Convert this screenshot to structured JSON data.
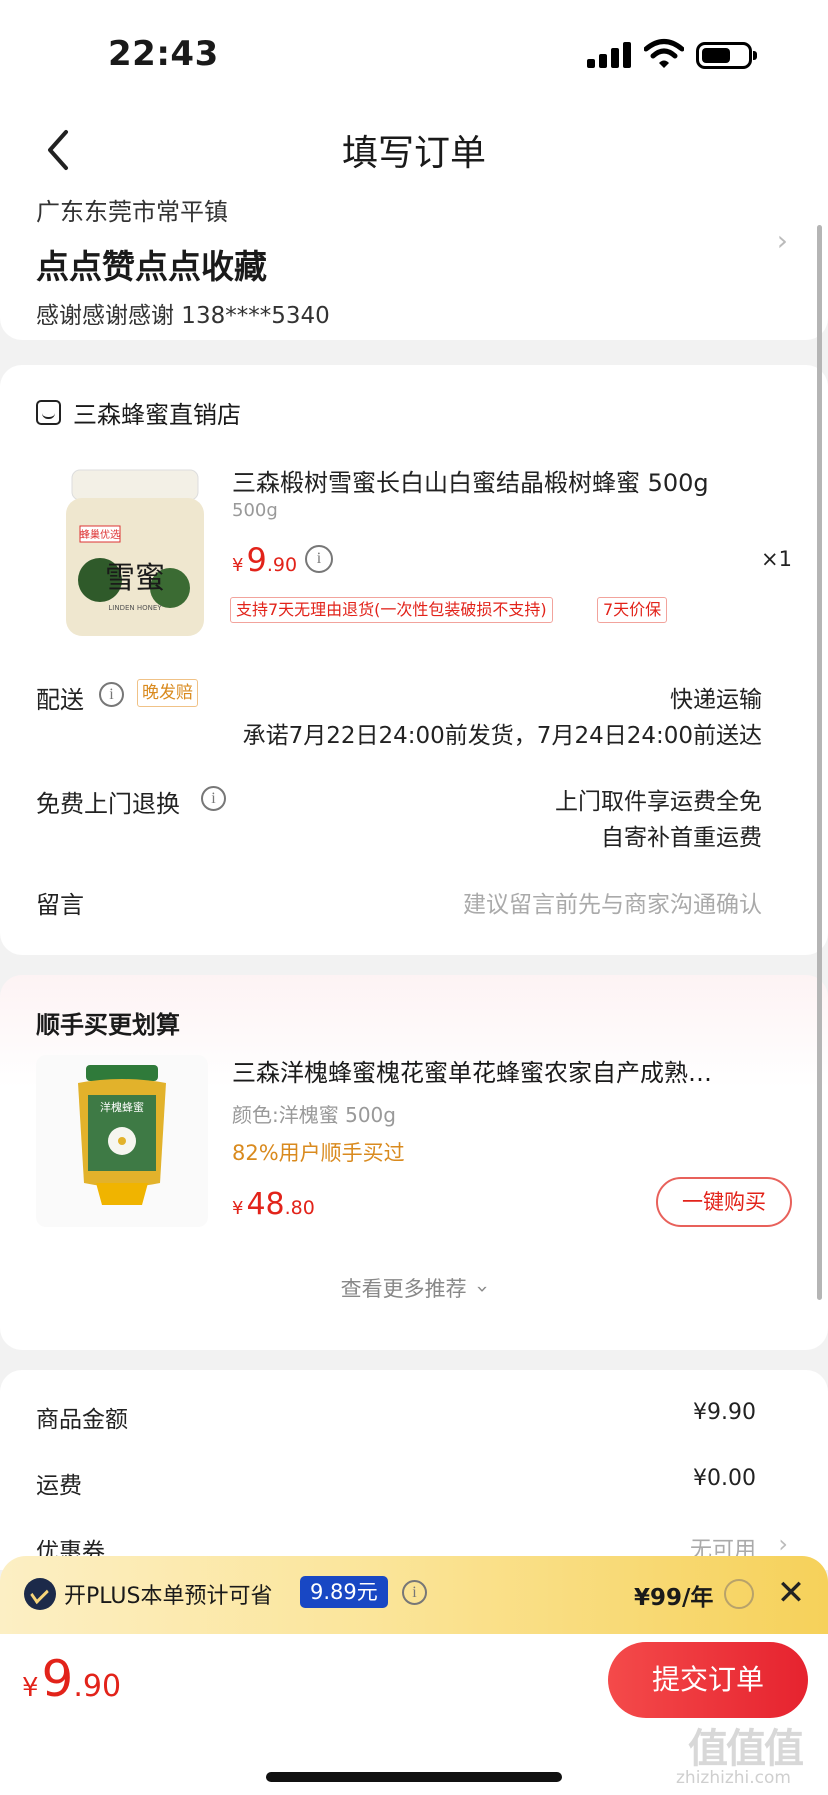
{
  "status_bar": {
    "time": "22:43"
  },
  "nav": {
    "title": "填写订单"
  },
  "address": {
    "region": "广东东莞市常平镇",
    "name": "点点赞点点收藏",
    "contact": "感谢感谢感谢  138****5340"
  },
  "order": {
    "shop_name": "三森蜂蜜直销店",
    "product": {
      "title": "三森椴树雪蜜长白山白蜜结晶椴树蜂蜜 500g",
      "spec": "500g",
      "price_symbol": "¥",
      "price_int": "9",
      "price_dec": ".90",
      "quantity": "×1",
      "tags": [
        "支持7天无理由退货(一次性包装破损不支持)",
        "7天价保"
      ],
      "image_labels": {
        "badge": "蜂巢优选",
        "name": "雪蜜",
        "english": "LINDEN HONEY"
      }
    },
    "delivery": {
      "label": "配送",
      "badge": "晚发赔",
      "method": "快递运输",
      "promise": "承诺7月22日24:00前发货，7月24日24:00前送达"
    },
    "return": {
      "label": "免费上门退换",
      "line1": "上门取件享运费全免",
      "line2": "自寄补首重运费"
    },
    "message": {
      "label": "留言",
      "placeholder": "建议留言前先与商家沟通确认"
    }
  },
  "recommend": {
    "title": "顺手买更划算",
    "item": {
      "name": "三森洋槐蜂蜜槐花蜜单花蜂蜜农家自产成熟…",
      "spec": "颜色:洋槐蜜 500g",
      "bought": "82%用户顺手买过",
      "price_symbol": "¥",
      "price_int": "48",
      "price_dec": ".80",
      "buy_label": "一键购买",
      "image_label": "洋槐蜂蜜"
    },
    "more_label": "查看更多推荐"
  },
  "summary": {
    "goods_label": "商品金额",
    "goods_value": "¥9.90",
    "shipping_label": "运费",
    "shipping_value": "¥0.00",
    "coupon_label": "优惠券",
    "coupon_value": "无可用"
  },
  "plus": {
    "text": "开PLUS本单预计可省",
    "amount": "9.89元",
    "price": "¥99/年"
  },
  "bottom": {
    "total_symbol": "¥",
    "total_int": "9",
    "total_dec": ".90",
    "submit_label": "提交订单",
    "watermark": "值值值",
    "watermark_sub": "zhizhizhi.com"
  },
  "colors": {
    "accent": "#e2231a",
    "plus_blue": "#1847c4",
    "badge_orange": "#d98a1e"
  },
  "icons": [
    "back-icon",
    "shop-icon",
    "info-icon",
    "chevron-right-icon",
    "chevron-down-icon",
    "plus-logo-icon",
    "close-icon"
  ]
}
